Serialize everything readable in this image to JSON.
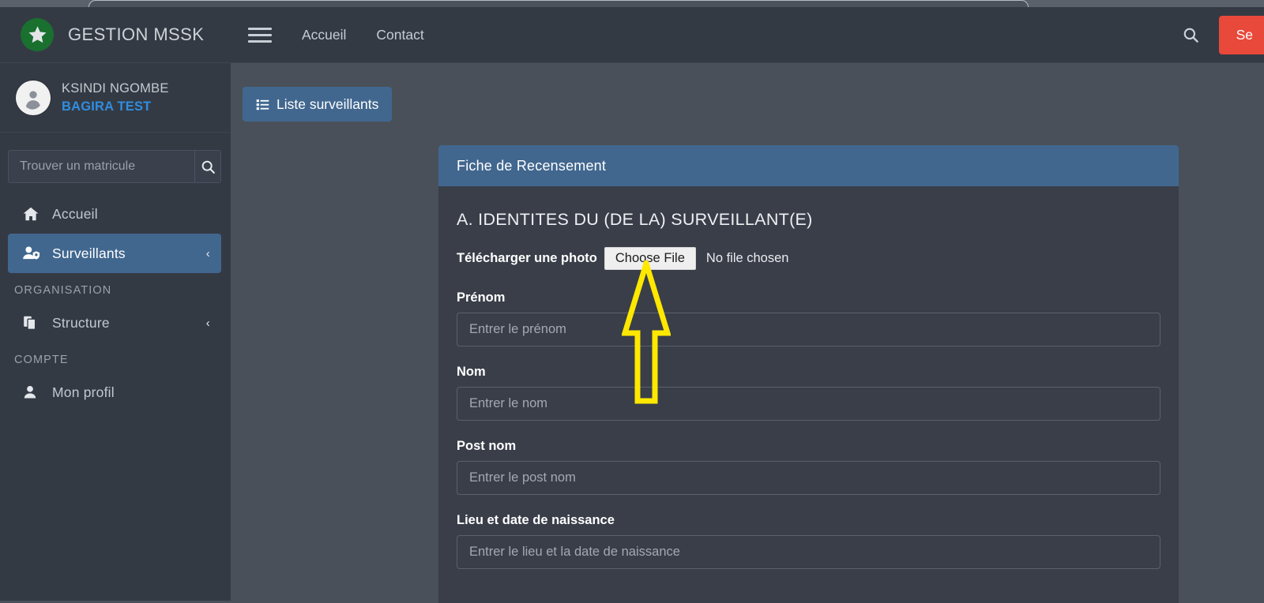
{
  "browser": {
    "tab_present": true
  },
  "sidebar": {
    "brand": {
      "title": "GESTION MSSK",
      "logo_icon": "star-icon"
    },
    "user": {
      "name": "KSINDI NGOMBE",
      "org": "BAGIRA TEST",
      "avatar_icon": "user-avatar-icon"
    },
    "search": {
      "placeholder": "Trouver un matricule",
      "value": "",
      "icon": "search-icon"
    },
    "items": [
      {
        "label": "Accueil",
        "icon": "home-icon",
        "active": false,
        "caret": ""
      },
      {
        "label": "Surveillants",
        "icon": "user-shield-icon",
        "active": true,
        "caret": "‹"
      }
    ],
    "groups": [
      {
        "heading": "ORGANISATION",
        "items": [
          {
            "label": "Structure",
            "icon": "copy-files-icon",
            "active": false,
            "caret": "‹"
          }
        ]
      },
      {
        "heading": "COMPTE",
        "items": [
          {
            "label": "Mon profil",
            "icon": "user-icon",
            "active": false,
            "caret": ""
          }
        ]
      }
    ]
  },
  "topbar": {
    "menu_toggle_icon": "hamburger-icon",
    "links": [
      {
        "label": "Accueil"
      },
      {
        "label": "Contact"
      }
    ],
    "search_icon": "search-icon",
    "logout_label": "Se"
  },
  "content": {
    "list_button": {
      "label": "Liste surveillants",
      "icon": "list-icon"
    },
    "panel": {
      "header": "Fiche de Recensement",
      "section_title": "A. IDENTITES DU (DE LA) SURVEILLANT(E)",
      "upload": {
        "label": "Télécharger une photo",
        "button_label": "Choose File",
        "status": "No file chosen"
      },
      "fields": [
        {
          "label": "Prénom",
          "placeholder": "Entrer le prénom",
          "value": ""
        },
        {
          "label": "Nom",
          "placeholder": "Entrer le nom",
          "value": ""
        },
        {
          "label": "Post nom",
          "placeholder": "Entrer le post nom",
          "value": ""
        },
        {
          "label": "Lieu et date de naissance",
          "placeholder": "Entrer le lieu et la date de naissance",
          "value": ""
        }
      ]
    }
  },
  "annotation": {
    "type": "arrow-up",
    "color": "#ffe800",
    "points_to": "Choose File"
  },
  "colors": {
    "sidebar_bg": "#343a44",
    "content_bg": "#4a5059",
    "panel_bg": "#393e49",
    "accent_blue": "#41678f",
    "logout_red": "#e8493a",
    "link_blue": "#2f8de0",
    "logo_green": "#19702f"
  }
}
